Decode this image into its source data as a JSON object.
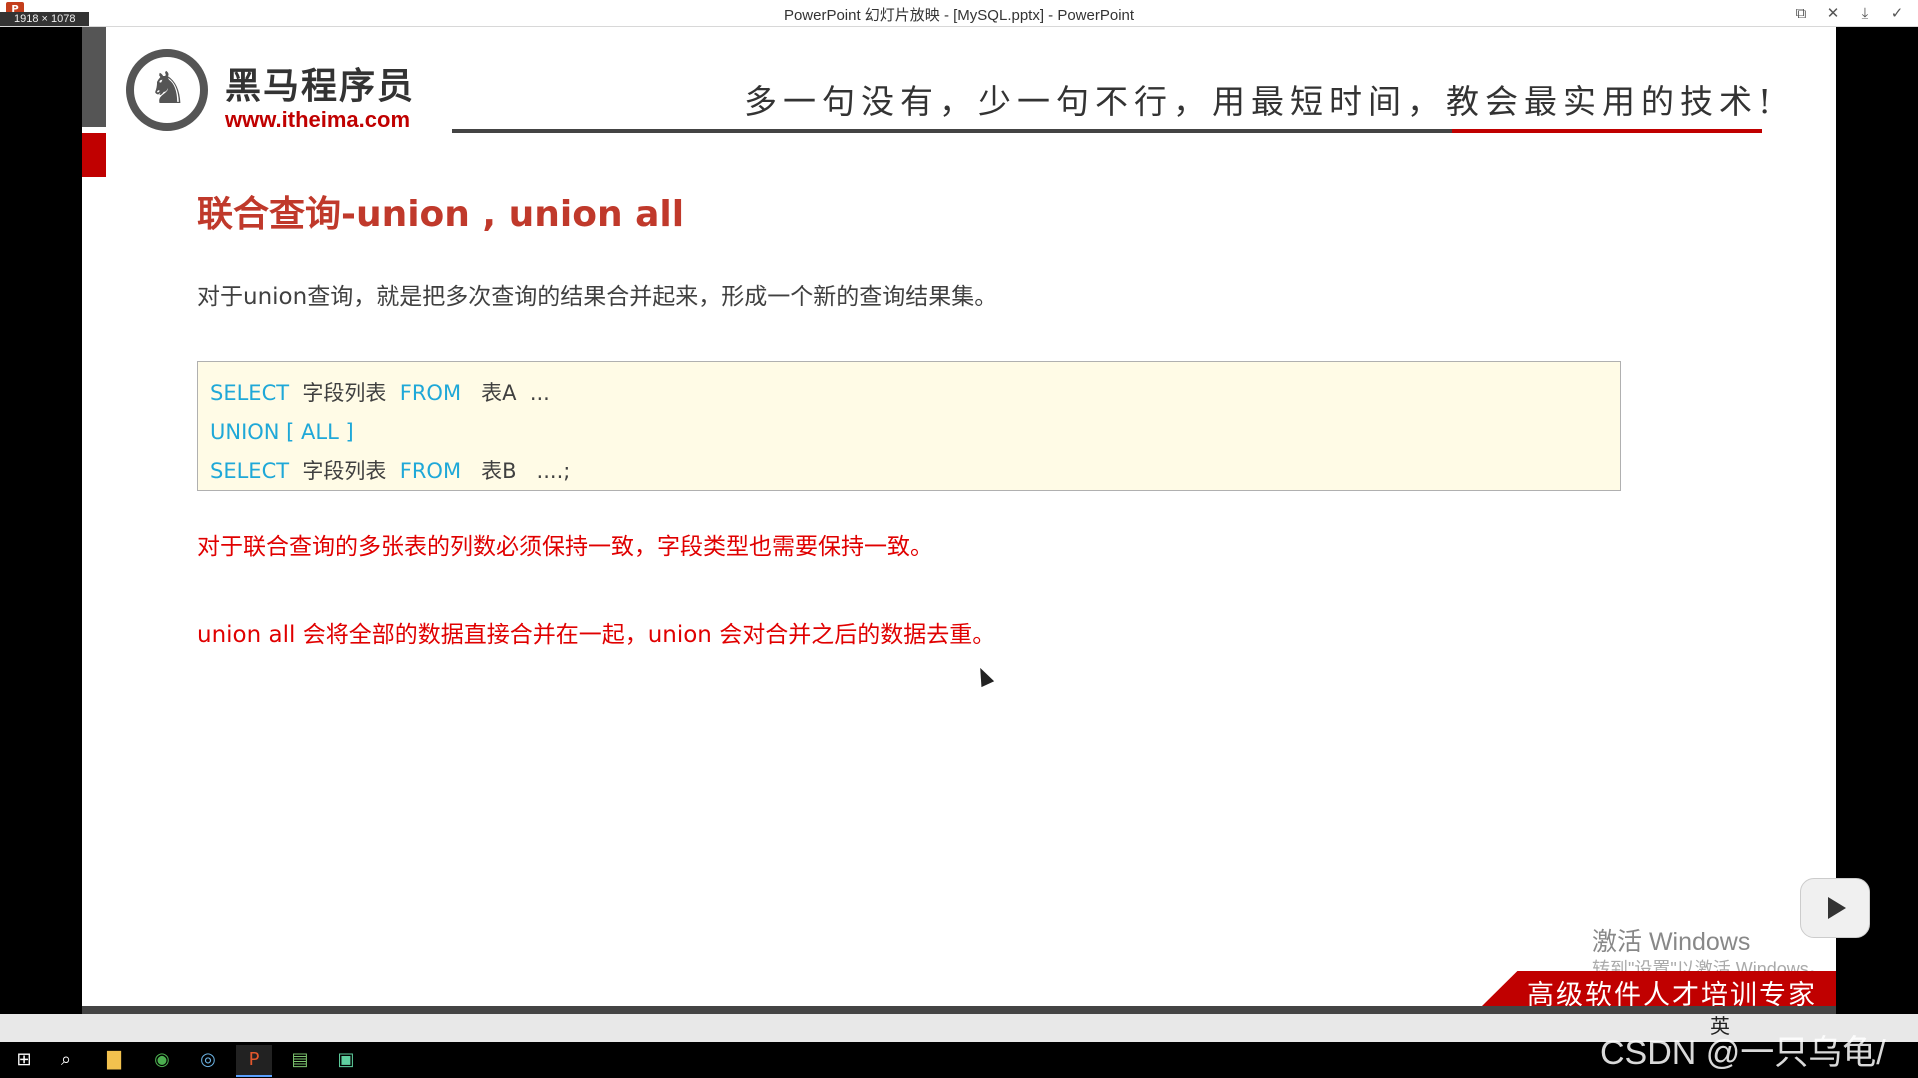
{
  "window": {
    "title": "PowerPoint 幻灯片放映 - [MySQL.pptx] - PowerPoint",
    "size_badge": "1918 × 1078",
    "app_icon": "P"
  },
  "slide": {
    "logo_cn": "黑马程序员",
    "logo_url": "www.itheima.com",
    "motto": "多一句没有，少一句不行，用最短时间，教会最实用的技术!",
    "title": "联合查询-union , union all",
    "intro": "对于union查询，就是把多次查询的结果合并起来，形成一个新的查询结果集。",
    "code": {
      "line1_kw1": "SELECT",
      "line1_t1": "  字段列表  ",
      "line1_kw2": "FROM",
      "line1_t2": "   表A  ...",
      "line2_kw": "UNION [ ALL ]",
      "line3_kw1": "SELECT",
      "line3_t1": "  字段列表  ",
      "line3_kw2": "FROM",
      "line3_t2": "   表B   ....;"
    },
    "rule1": "对于联合查询的多张表的列数必须保持一致，字段类型也需要保持一致。",
    "rule2": "union all 会将全部的数据直接合并在一起，union 会对合并之后的数据去重。",
    "slogan": "高级软件人才培训专家",
    "activate_title": "激活 Windows",
    "activate_sub": "转到\"设置\"以激活 Windows。"
  },
  "overlay": {
    "watermark": "CSDN @一只乌龟/",
    "ime": "英"
  },
  "colors": {
    "title_red": "#c0392b",
    "keyword_blue": "#1fa8d8",
    "rule_red": "#e00000",
    "code_bg": "#fffbe6"
  },
  "taskbar": {
    "icons": [
      "windows-start-icon",
      "search-icon",
      "file-explorer-icon",
      "chrome-icon",
      "browser-icon",
      "powerpoint-icon",
      "notepad-icon",
      "datagrip-icon"
    ]
  }
}
